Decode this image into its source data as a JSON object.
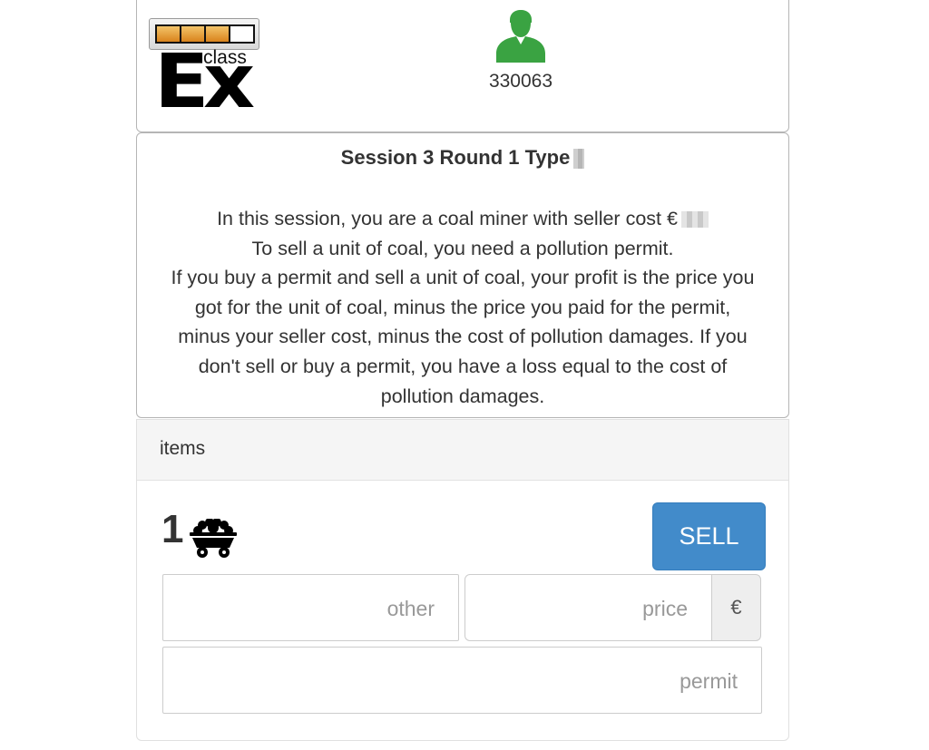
{
  "logo": {
    "text_main": "Ex",
    "text_sub": "class",
    "meter_fill": 0.75
  },
  "user": {
    "id": "330063",
    "icon": "user-icon",
    "color": "#3aa342"
  },
  "info": {
    "title": "Session 3 Round 1 Type",
    "lines": [
      "In this session, you are a coal miner with seller cost €",
      "To sell a unit of coal, you need a pollution permit.",
      "If you buy a permit and sell a unit of coal, your profit is the price you",
      "got for the unit of coal, minus the price you paid for the permit,",
      "minus your seller cost, minus the cost of pollution damages. If you",
      "don't sell or buy a permit, you have a loss equal to the cost of",
      "pollution damages."
    ]
  },
  "items": {
    "heading": "items",
    "quantity": "1",
    "item_icon": "coal-cart-icon",
    "sell_label": "SELL",
    "accent_color": "#428bca",
    "fields": {
      "other_placeholder": "other",
      "price_placeholder": "price",
      "currency": "€",
      "permit_placeholder": "permit"
    }
  }
}
